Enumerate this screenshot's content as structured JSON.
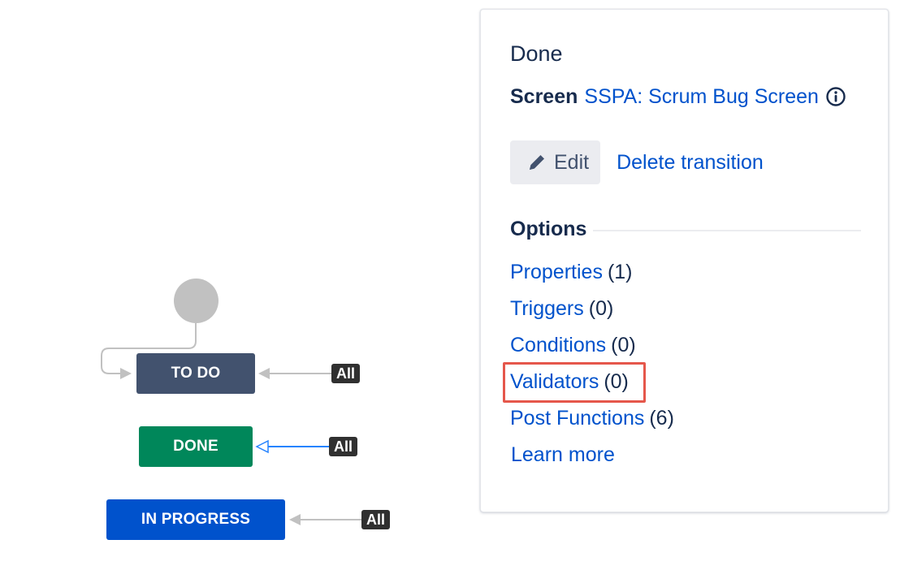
{
  "diagram": {
    "statuses": [
      {
        "label": "TO DO",
        "color": "#42526e"
      },
      {
        "label": "DONE",
        "color": "#00875a"
      },
      {
        "label": "IN PROGRESS",
        "color": "#0052cc"
      }
    ],
    "all_badge_label": "All",
    "selected_transition": "DONE"
  },
  "panel": {
    "title": "Done",
    "screen_label": "Screen",
    "screen_link": "SSPA: Scrum Bug Screen",
    "info_icon": "info-icon",
    "edit_icon": "pencil-icon",
    "edit_label": "Edit",
    "delete_label": "Delete transition",
    "options_title": "Options",
    "options": [
      {
        "label": "Properties",
        "count": "(1)"
      },
      {
        "label": "Triggers",
        "count": "(0)"
      },
      {
        "label": "Conditions",
        "count": "(0)"
      },
      {
        "label": "Validators",
        "count": "(0)",
        "highlighted": true
      },
      {
        "label": "Post Functions",
        "count": "(6)"
      }
    ],
    "learn_more": "Learn more"
  },
  "colors": {
    "link": "#0052cc",
    "text": "#172b4d",
    "highlight": "#e5574b",
    "badge": "#303030",
    "start_node": "#c1c1c1",
    "selected_arrow": "#2684ff"
  }
}
